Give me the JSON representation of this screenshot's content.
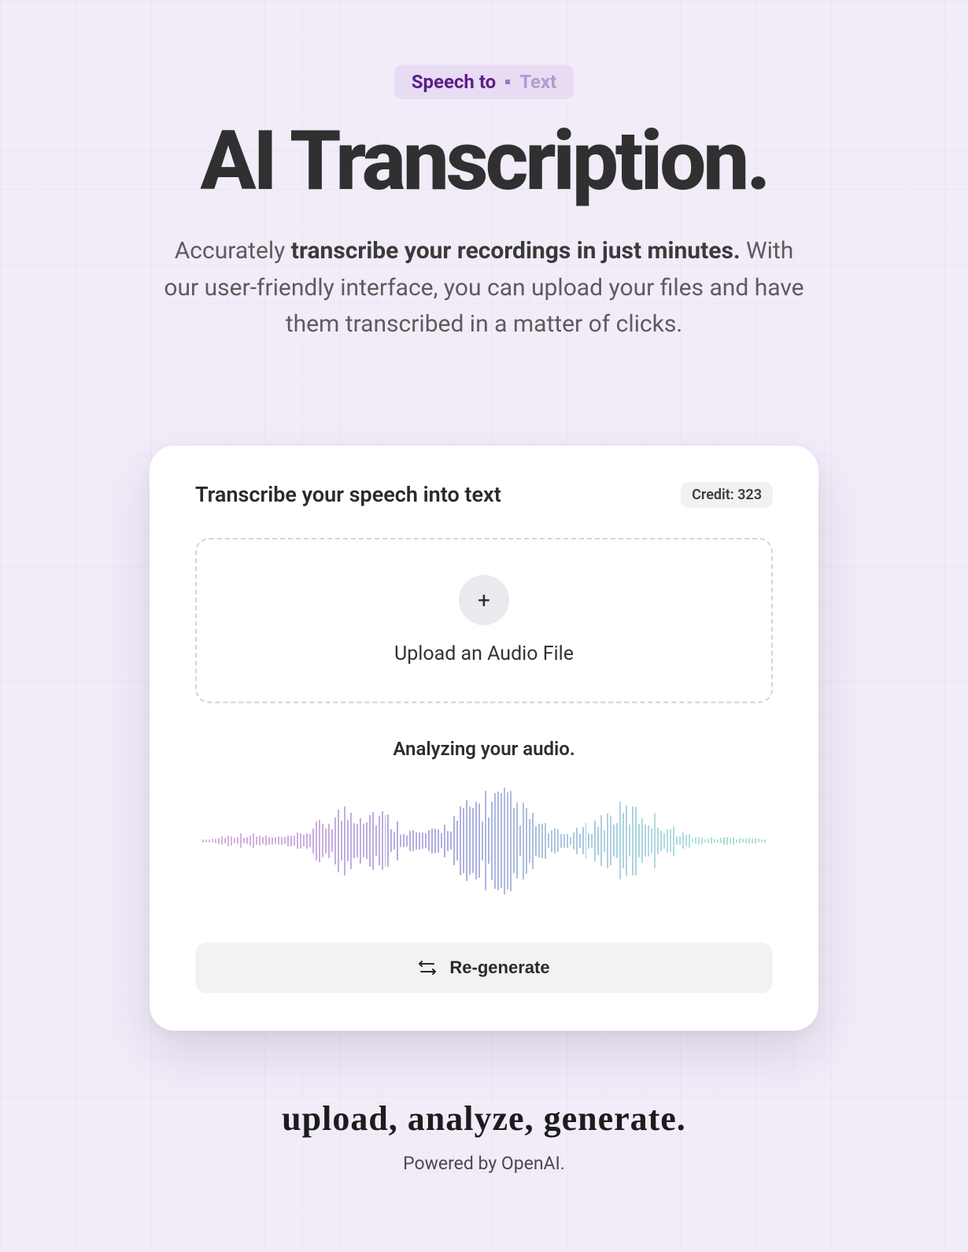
{
  "pill": {
    "dark": "Speech to",
    "light": "Text"
  },
  "hero": {
    "title": "AI Transcription.",
    "sub_pre": "Accurately ",
    "sub_bold": "transcribe your recordings in just minutes.",
    "sub_post": " With our user-friendly interface, you can upload your files and have them transcribed in a matter of clicks."
  },
  "card": {
    "title": "Transcribe your speech into text",
    "credit_label": "Credit: 323",
    "upload_label": "Upload an Audio File",
    "status": "Analyzing your audio.",
    "regenerate_label": "Re-generate"
  },
  "footer": {
    "tagline": "upload, analyze, generate.",
    "powered": "Powered by OpenAI."
  }
}
